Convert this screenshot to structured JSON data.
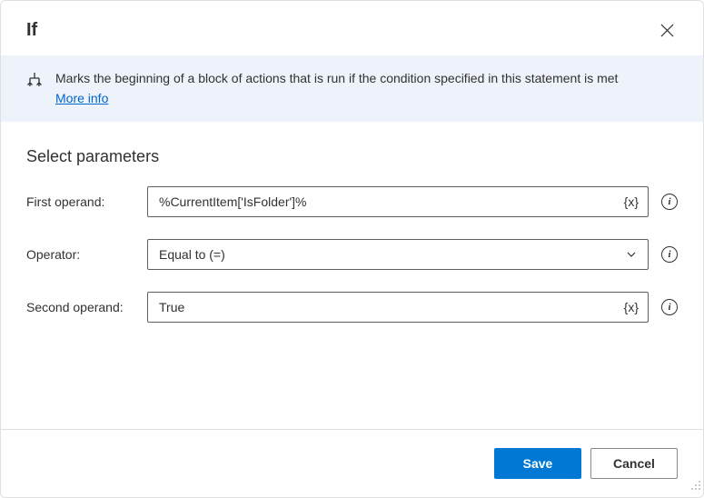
{
  "dialog": {
    "title": "If",
    "description": "Marks the beginning of a block of actions that is run if the condition specified in this statement is met",
    "more_info_label": "More info"
  },
  "section": {
    "title": "Select parameters"
  },
  "fields": {
    "first_operand": {
      "label": "First operand:",
      "value": "%CurrentItem['IsFolder']%",
      "var_icon": "{x}"
    },
    "operator": {
      "label": "Operator:",
      "value": "Equal to (=)"
    },
    "second_operand": {
      "label": "Second operand:",
      "value": "True",
      "var_icon": "{x}"
    }
  },
  "help_icon_char": "i",
  "footer": {
    "save_label": "Save",
    "cancel_label": "Cancel"
  }
}
